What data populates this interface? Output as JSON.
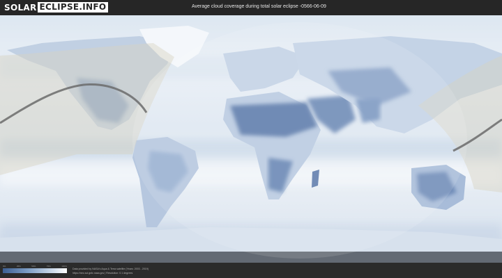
{
  "header": {
    "logo_part1": "SOLAR",
    "logo_part2": "ECLIPSE.INFO",
    "title": "Average cloud coverage during total solar eclipse -0566-06-09"
  },
  "legend": {
    "tick_labels": [
      "0%",
      "25%",
      "50%",
      "75%",
      "100%"
    ],
    "colors": {
      "clear": "#3d5f93",
      "cloudy": "#ffffff"
    }
  },
  "footer": {
    "credit_line1": "Data provided by NASA's Aqua & Terra satellite (Years: 2003 - 2019)",
    "credit_line2": "https://neo.sci.gsfc.nasa.gov | Resolution: 0.1 degrees"
  },
  "map": {
    "colors": {
      "ocean_cloudy": "#e5edf5",
      "land_clear": "#5d7cab",
      "shadow_band": "#d9d4c7",
      "eclipse_path": "#6b6b6b"
    }
  }
}
